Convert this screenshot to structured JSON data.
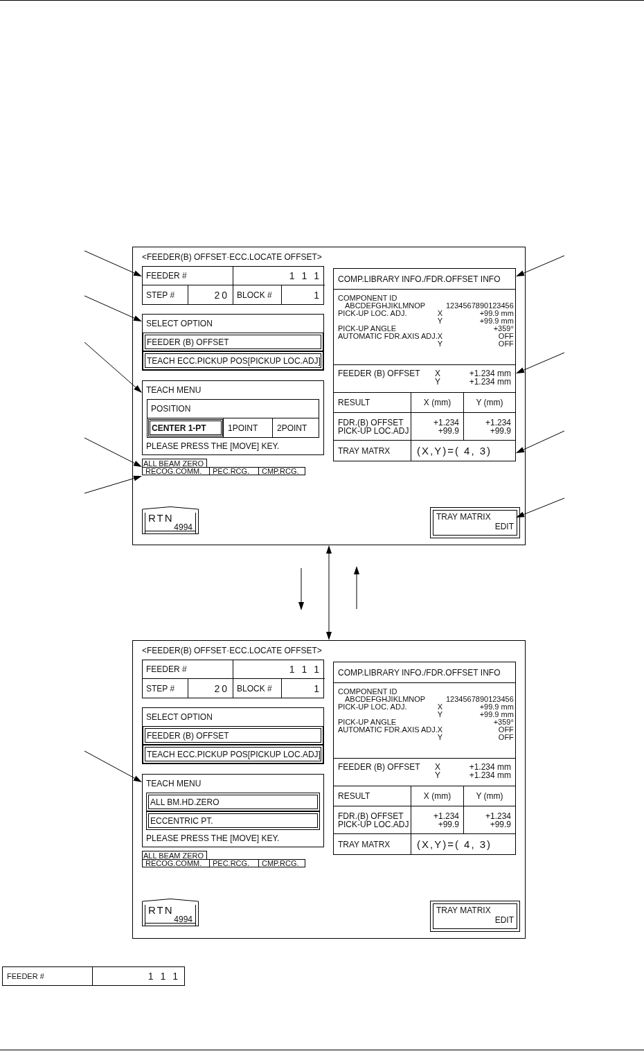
{
  "screens": [
    {
      "title": "<FEEDER(B) OFFSET·ECC.LOCATE OFFSET>",
      "feeder": {
        "label": "FEEDER #",
        "value": "1 1 1"
      },
      "step": {
        "label": "STEP #",
        "value": "20"
      },
      "block": {
        "label": "BLOCK #",
        "value": "1"
      },
      "select_option": {
        "title": "SELECT OPTION",
        "options": [
          "FEEDER (B) OFFSET",
          "TEACH ECC.PICKUP POS[PICKUP LOC.ADJ]"
        ]
      },
      "teach_menu": {
        "title": "TEACH MENU",
        "kind": "position",
        "header": "POSITION",
        "options": [
          {
            "label": "CENTER 1-PT",
            "selected": true
          },
          {
            "label": "1POINT",
            "selected": false
          },
          {
            "label": "2POINT",
            "selected": false
          }
        ],
        "message": "PLEASE PRESS THE [MOVE] KEY."
      },
      "beam_zero": "ALL BEAM ZERO",
      "recog_tabs": [
        "RECOG.COMM.",
        "PEC.RCG.",
        "CMP.RCG."
      ],
      "rtn": {
        "label": "RTN",
        "code": "4994"
      },
      "info": {
        "title": "COMP.LIBRARY INFO./FDR.OFFSET INFO",
        "component_label": "COMPONENT ID",
        "component_name": "ABCDEFGHJIKLMNOP",
        "component_code": "1234567890123456",
        "rows": [
          {
            "label": "PICK-UP LOC. ADJ.",
            "axis": "X",
            "value": "+99.9 mm"
          },
          {
            "axis": "Y",
            "value": "+99.9 mm"
          },
          {
            "label": "PICK-UP ANGLE",
            "value": "+359°"
          },
          {
            "label": "AUTOMATIC FDR.AXIS ADJ.",
            "axis": "X",
            "value": "OFF"
          },
          {
            "axis": "Y",
            "value": "OFF"
          }
        ],
        "offset_label": "FEEDER (B) OFFSET",
        "offset_rows": [
          {
            "axis": "X",
            "value": "+1.234 mm"
          },
          {
            "axis": "Y",
            "value": "+1.234 mm"
          }
        ]
      },
      "result": {
        "columns": [
          "RESULT",
          "X (mm)",
          "Y (mm)"
        ],
        "row_labels": [
          "FDR.(B) OFFSET",
          "PICK-UP LOC.ADJ"
        ],
        "x_values": [
          "+1.234",
          "+99.9"
        ],
        "y_values": [
          "+1.234",
          "+99.9"
        ],
        "tray_label": "TRAY MATRX",
        "tray_value": "(X,Y)=( 4, 3)"
      },
      "tray_button": {
        "label": "TRAY MATRIX",
        "sub": "EDIT"
      }
    },
    {
      "title": "<FEEDER(B) OFFSET·ECC.LOCATE OFFSET>",
      "feeder": {
        "label": "FEEDER #",
        "value": "1 1 1"
      },
      "step": {
        "label": "STEP #",
        "value": "20"
      },
      "block": {
        "label": "BLOCK #",
        "value": "1"
      },
      "select_option": {
        "title": "SELECT OPTION",
        "options": [
          "FEEDER (B) OFFSET",
          "TEACH ECC.PICKUP POS[PICKUP LOC.ADJ]"
        ]
      },
      "teach_menu": {
        "title": "TEACH MENU",
        "kind": "list",
        "items": [
          "ALL BM.HD.ZERO",
          "ECCENTRIC PT."
        ],
        "message": "PLEASE PRESS THE [MOVE] KEY."
      },
      "beam_zero": "ALL BEAM ZERO",
      "recog_tabs": [
        "RECOG.COMM.",
        "PEC.RCG.",
        "CMP.RCG."
      ],
      "rtn": {
        "label": "RTN",
        "code": "4994"
      },
      "info": {
        "title": "COMP.LIBRARY INFO./FDR.OFFSET INFO",
        "component_label": "COMPONENT ID",
        "component_name": "ABCDEFGHJIKLMNOP",
        "component_code": "1234567890123456",
        "rows": [
          {
            "label": "PICK-UP LOC. ADJ.",
            "axis": "X",
            "value": "+99.9 mm"
          },
          {
            "axis": "Y",
            "value": "+99.9 mm"
          },
          {
            "label": "PICK-UP ANGLE",
            "value": "+359°"
          },
          {
            "label": "AUTOMATIC FDR.AXIS ADJ.",
            "axis": "X",
            "value": "OFF"
          },
          {
            "axis": "Y",
            "value": "OFF"
          }
        ],
        "offset_label": "FEEDER (B) OFFSET",
        "offset_rows": [
          {
            "axis": "X",
            "value": "+1.234 mm"
          },
          {
            "axis": "Y",
            "value": "+1.234 mm"
          }
        ]
      },
      "result": {
        "columns": [
          "RESULT",
          "X (mm)",
          "Y (mm)"
        ],
        "row_labels": [
          "FDR.(B) OFFSET",
          "PICK-UP LOC.ADJ"
        ],
        "x_values": [
          "+1.234",
          "+99.9"
        ],
        "y_values": [
          "+1.234",
          "+99.9"
        ],
        "tray_label": "TRAY MATRX",
        "tray_value": "(X,Y)=( 4, 3)"
      },
      "tray_button": {
        "label": "TRAY MATRIX",
        "sub": "EDIT"
      }
    }
  ],
  "feeder_detail": {
    "label": "FEEDER #",
    "value": "1 1 1"
  }
}
